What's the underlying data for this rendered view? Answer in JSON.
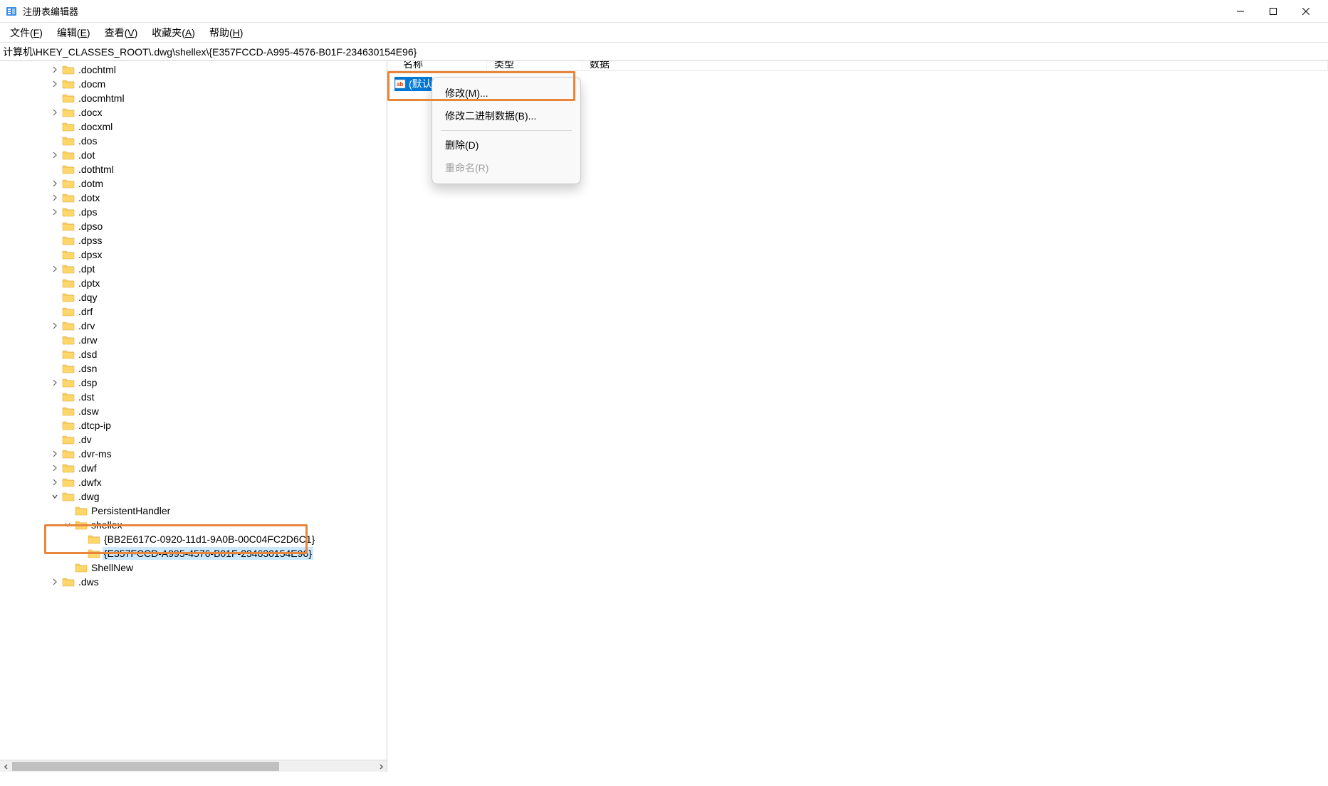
{
  "window": {
    "title": "注册表编辑器"
  },
  "menu": {
    "file": "文件(F)",
    "edit": "编辑(E)",
    "view": "查看(V)",
    "favorites": "收藏夹(A)",
    "help": "帮助(H)"
  },
  "address": "计算机\\HKEY_CLASSES_ROOT\\.dwg\\shellex\\{E357FCCD-A995-4576-B01F-234630154E96}",
  "tree": {
    "items": [
      {
        "indent": 2,
        "label": ".dochtml",
        "chevron": "right"
      },
      {
        "indent": 2,
        "label": ".docm",
        "chevron": "right"
      },
      {
        "indent": 2,
        "label": ".docmhtml",
        "chevron": "none"
      },
      {
        "indent": 2,
        "label": ".docx",
        "chevron": "right"
      },
      {
        "indent": 2,
        "label": ".docxml",
        "chevron": "none"
      },
      {
        "indent": 2,
        "label": ".dos",
        "chevron": "none"
      },
      {
        "indent": 2,
        "label": ".dot",
        "chevron": "right"
      },
      {
        "indent": 2,
        "label": ".dothtml",
        "chevron": "none"
      },
      {
        "indent": 2,
        "label": ".dotm",
        "chevron": "right"
      },
      {
        "indent": 2,
        "label": ".dotx",
        "chevron": "right"
      },
      {
        "indent": 2,
        "label": ".dps",
        "chevron": "right"
      },
      {
        "indent": 2,
        "label": ".dpso",
        "chevron": "none"
      },
      {
        "indent": 2,
        "label": ".dpss",
        "chevron": "none"
      },
      {
        "indent": 2,
        "label": ".dpsx",
        "chevron": "none"
      },
      {
        "indent": 2,
        "label": ".dpt",
        "chevron": "right"
      },
      {
        "indent": 2,
        "label": ".dptx",
        "chevron": "none"
      },
      {
        "indent": 2,
        "label": ".dqy",
        "chevron": "none"
      },
      {
        "indent": 2,
        "label": ".drf",
        "chevron": "none"
      },
      {
        "indent": 2,
        "label": ".drv",
        "chevron": "right"
      },
      {
        "indent": 2,
        "label": ".drw",
        "chevron": "none"
      },
      {
        "indent": 2,
        "label": ".dsd",
        "chevron": "none"
      },
      {
        "indent": 2,
        "label": ".dsn",
        "chevron": "none"
      },
      {
        "indent": 2,
        "label": ".dsp",
        "chevron": "right"
      },
      {
        "indent": 2,
        "label": ".dst",
        "chevron": "none"
      },
      {
        "indent": 2,
        "label": ".dsw",
        "chevron": "none"
      },
      {
        "indent": 2,
        "label": ".dtcp-ip",
        "chevron": "none"
      },
      {
        "indent": 2,
        "label": ".dv",
        "chevron": "none"
      },
      {
        "indent": 2,
        "label": ".dvr-ms",
        "chevron": "right"
      },
      {
        "indent": 2,
        "label": ".dwf",
        "chevron": "right"
      },
      {
        "indent": 2,
        "label": ".dwfx",
        "chevron": "right"
      },
      {
        "indent": 2,
        "label": ".dwg",
        "chevron": "down"
      },
      {
        "indent": 3,
        "label": "PersistentHandler",
        "chevron": "none"
      },
      {
        "indent": 3,
        "label": "shellex",
        "chevron": "down"
      },
      {
        "indent": 4,
        "label": "{BB2E617C-0920-11d1-9A0B-00C04FC2D6C1}",
        "chevron": "none"
      },
      {
        "indent": 4,
        "label": "{E357FCCD-A995-4576-B01F-234630154E96}",
        "chevron": "none",
        "selected": true
      },
      {
        "indent": 3,
        "label": "ShellNew",
        "chevron": "none"
      },
      {
        "indent": 2,
        "label": ".dws",
        "chevron": "right"
      }
    ]
  },
  "columns": {
    "name": "名称",
    "type": "类型",
    "data": "数据"
  },
  "value_row": {
    "name": "(默认",
    "icon_text": "ab"
  },
  "context_menu": {
    "modify": "修改(M)...",
    "modify_binary": "修改二进制数据(B)...",
    "delete": "删除(D)",
    "rename": "重命名(R)"
  }
}
